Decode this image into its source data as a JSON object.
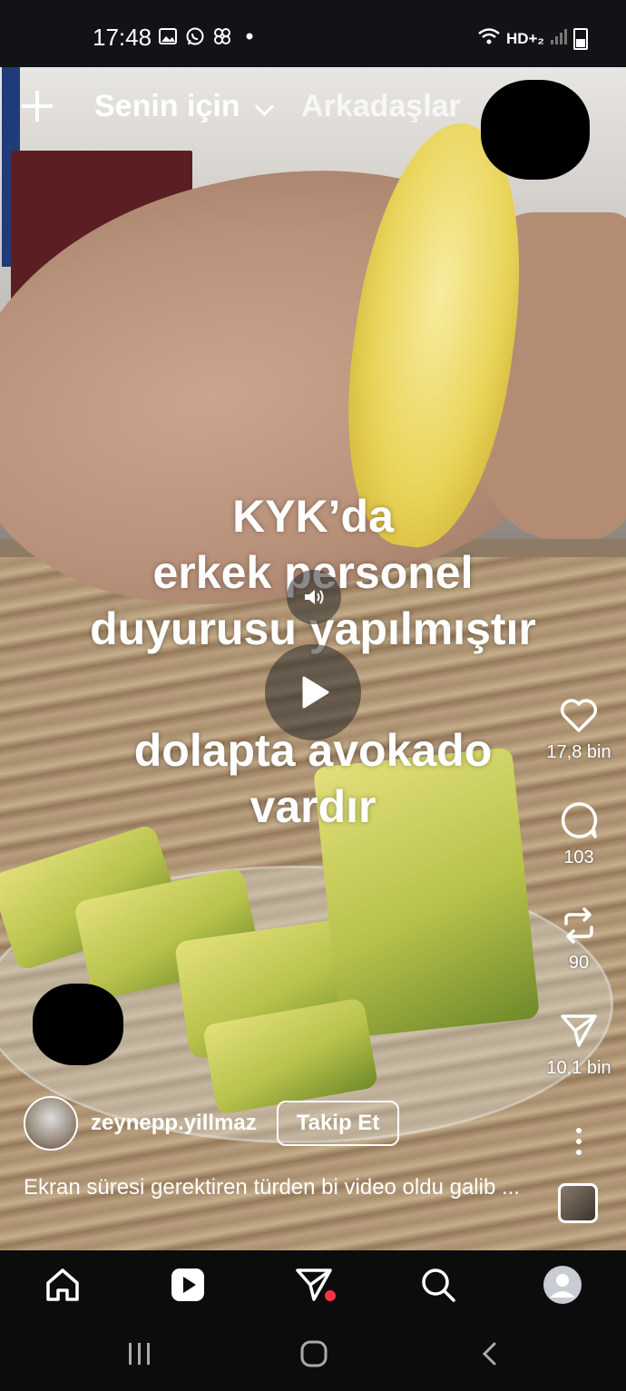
{
  "status_bar": {
    "time": "17:48",
    "network": "HD+₂",
    "icons": [
      "gallery-icon",
      "whatsapp-icon",
      "pinwheel-icon",
      "dot-icon",
      "wifi-icon",
      "signal-icon",
      "battery-icon"
    ]
  },
  "header": {
    "tabs": [
      {
        "label": "Senin için",
        "active": true
      },
      {
        "label": "Arkadaşlar",
        "active": false
      }
    ]
  },
  "video": {
    "overlay_text_line1": "KYK’da\nerkek personel\nduyurusu yapılmıştır",
    "overlay_text_line2": "dolapta avokado\nvardır"
  },
  "actions": {
    "likes": "17,8 bin",
    "comments": "103",
    "reposts": "90",
    "shares": "10,1 bin"
  },
  "author": {
    "username": "zeynepp.yillmaz",
    "follow_label": "Takip Et"
  },
  "caption": "Ekran süresi gerektiren türden bi video oldu galib ...",
  "bottom_nav": {
    "items": [
      "home-icon",
      "reels-icon",
      "messages-icon",
      "search-icon",
      "profile-icon"
    ],
    "notification_color": "#ff3040"
  }
}
